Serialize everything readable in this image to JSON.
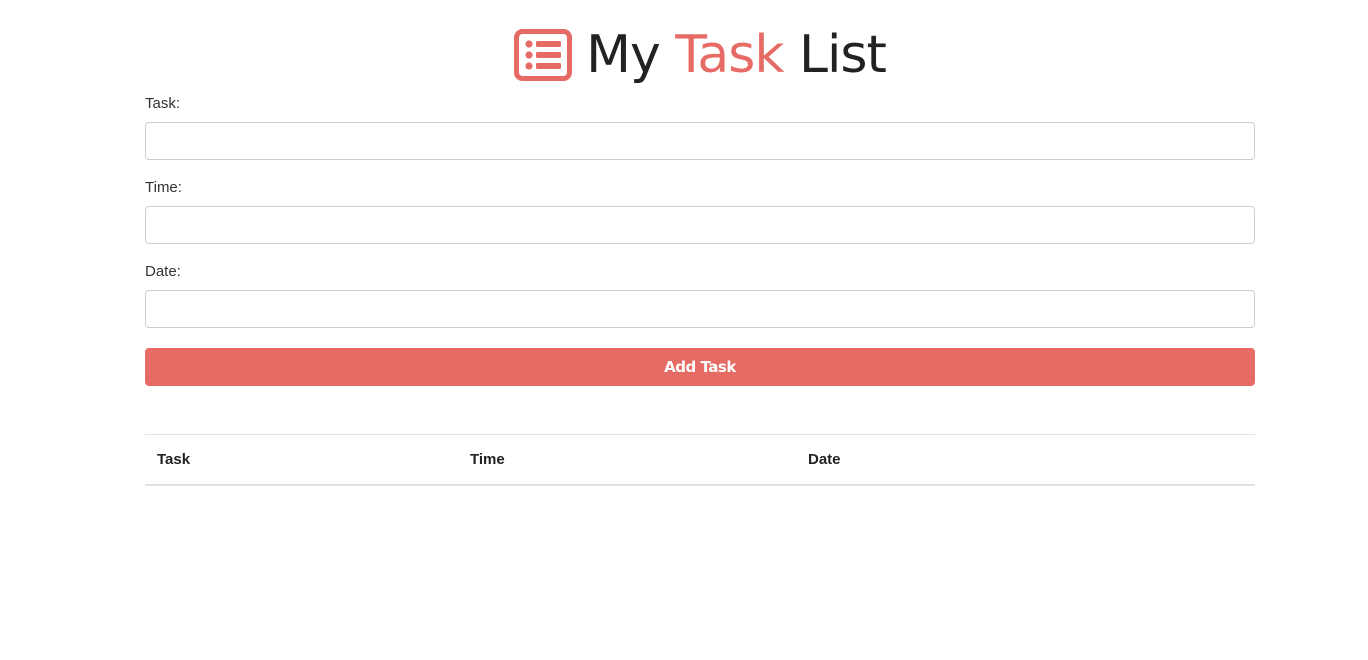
{
  "header": {
    "icon": "list-alt-icon",
    "title_part1": "My ",
    "title_accent": "Task",
    "title_part2": " List",
    "accent_color": "#e66b65"
  },
  "form": {
    "task_label": "Task:",
    "task_value": "",
    "time_label": "Time:",
    "time_value": "",
    "date_label": "Date:",
    "date_value": "",
    "add_button_label": "Add Task"
  },
  "table": {
    "headers": [
      "Task",
      "Time",
      "Date"
    ],
    "rows": []
  }
}
